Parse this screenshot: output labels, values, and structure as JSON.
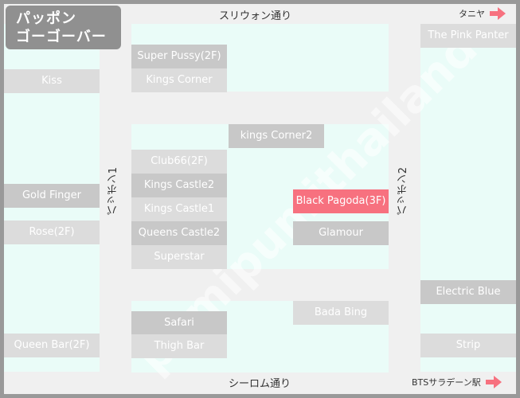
{
  "title": {
    "line1": "パッポン",
    "line2": "ゴーゴーバー"
  },
  "streets": {
    "top": "スリウォン通り",
    "bottom": "シーロム通り",
    "left_lane": "パッポン1",
    "right_lane": "パッポン2"
  },
  "directions": {
    "top_right": {
      "label": "タニヤ",
      "icon": "arrow-right-icon"
    },
    "bottom_right": {
      "label": "BTSサラデーン駅",
      "icon": "arrow-right-icon"
    }
  },
  "watermark": "pumipumithailand.",
  "colors": {
    "frame": "#999999",
    "road": "#f0f0f0",
    "block": "#eafcf8",
    "shop_dark": "#c8c8c8",
    "shop_light": "#dcdcdc",
    "highlight": "#f7717f",
    "arrow": "#f7717f"
  },
  "shops": {
    "kiss": "Kiss",
    "gold_finger": "Gold Finger",
    "rose": "Rose(2F)",
    "queen_bar": "Queen Bar(2F)",
    "super_pussy": "Super Pussy(2F)",
    "kings_corner": "Kings Corner",
    "kings_corner2": "kings Corner2",
    "club66": "Club66(2F)",
    "kings_castle2": "Kings Castle2",
    "kings_castle1": "Kings Castle1",
    "queens_castle2": "Queens Castle2",
    "superstar": "Superstar",
    "black_pagoda": "Black Pagoda(3F)",
    "glamour": "Glamour",
    "safari": "Safari",
    "thigh_bar": "Thigh Bar",
    "bada_bing": "Bada Bing",
    "pink_panter": "The Pink Panter",
    "electric_blue": "Electric Blue",
    "strip": "Strip"
  }
}
